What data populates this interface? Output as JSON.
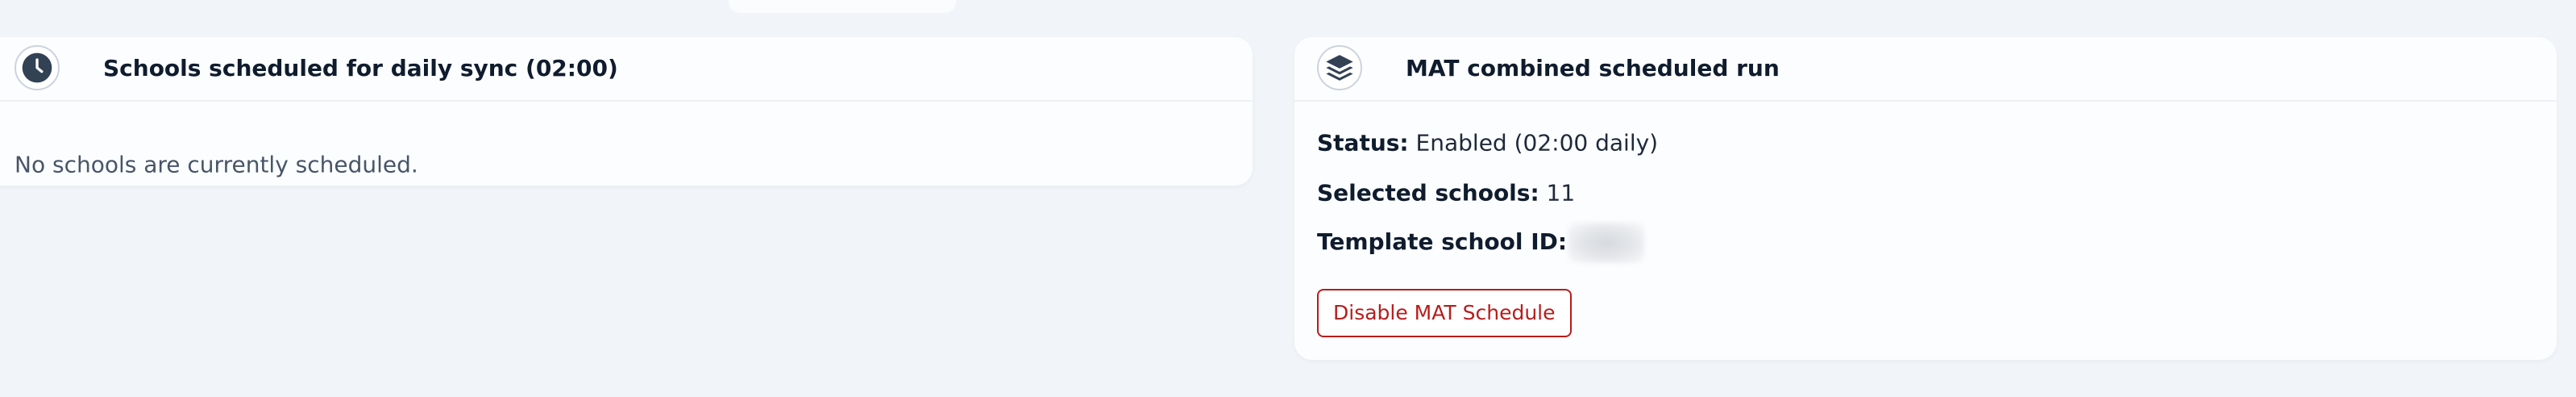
{
  "left_card": {
    "icon": "clock-icon",
    "title": "Schools scheduled for daily sync (02:00)",
    "empty_message": "No schools are currently scheduled."
  },
  "right_card": {
    "icon": "layers-icon",
    "title": "MAT combined scheduled run",
    "status_label": "Status:",
    "status_value": "Enabled (02:00 daily)",
    "selected_label": "Selected schools:",
    "selected_value": "11",
    "template_label": "Template school ID:",
    "disable_button": "Disable MAT Schedule"
  },
  "colors": {
    "background": "#f1f4f8",
    "icon_dark": "#334155",
    "danger": "#b91c1c"
  }
}
